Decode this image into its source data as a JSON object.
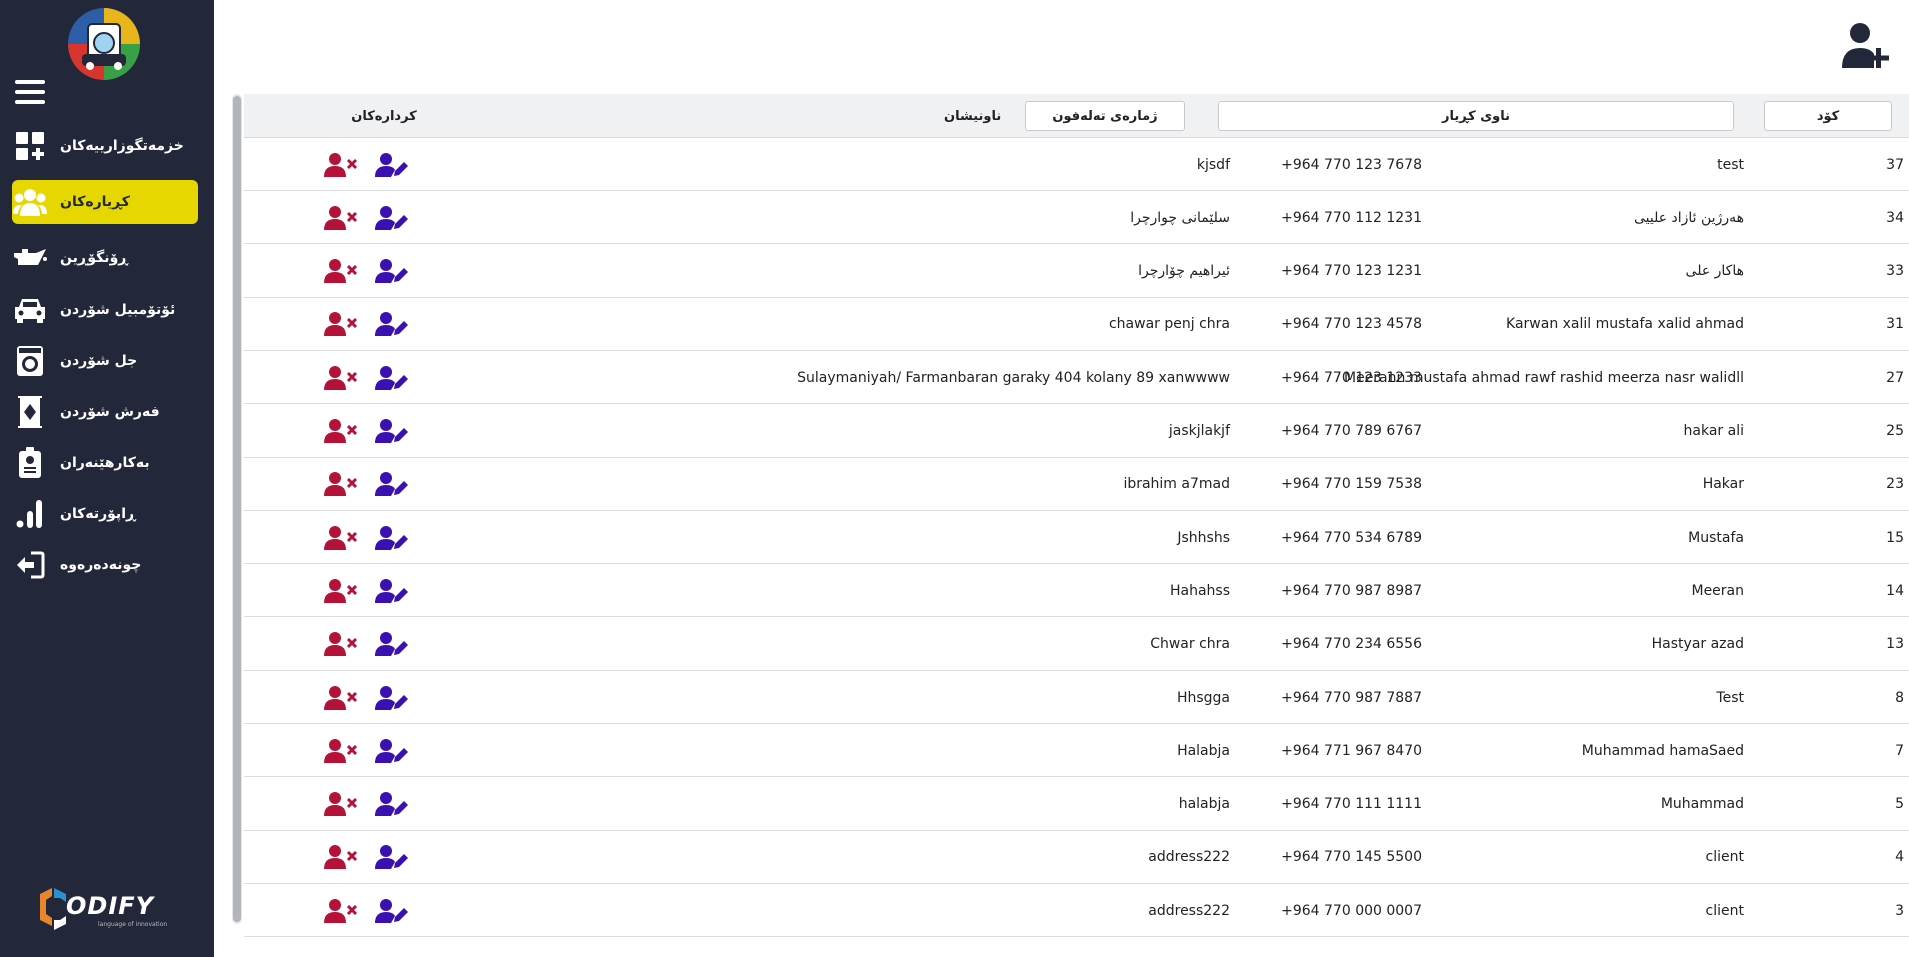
{
  "sidebar": {
    "items": [
      {
        "label": "خزمەتگوزارییەکان",
        "icon": "services-grid-icon",
        "active": false
      },
      {
        "label": "کڕیارەکان",
        "icon": "customers-group-icon",
        "active": true
      },
      {
        "label": "ڕۆنگۆڕین",
        "icon": "oil-can-icon",
        "active": false
      },
      {
        "label": "ئۆتۆمبیل شۆردن",
        "icon": "car-icon",
        "active": false
      },
      {
        "label": "جل شۆردن",
        "icon": "washing-machine-icon",
        "active": false
      },
      {
        "label": "فەرش شۆردن",
        "icon": "carpet-icon",
        "active": false
      },
      {
        "label": "بەکارهێنەران",
        "icon": "id-badge-icon",
        "active": false
      },
      {
        "label": "ڕاپۆرتەکان",
        "icon": "bar-chart-icon",
        "active": false
      },
      {
        "label": "چونەدەرەوە",
        "icon": "logout-icon",
        "active": false
      }
    ]
  },
  "brand": {
    "name": "ODIFY",
    "tagline": "language of innovation"
  },
  "table": {
    "headers": {
      "code": "کۆد",
      "name": "ناوی کڕیار",
      "phone": "ژمارەی تەلەفون",
      "address": "ناونیشان",
      "actions": "کردارەکان"
    },
    "rows": [
      {
        "code": "37",
        "name": "test",
        "phone": "+964 770 123 7678",
        "address": "kjsdf"
      },
      {
        "code": "34",
        "name": "هەرژین ئازاد علییی",
        "phone": "+964 770 112 1231",
        "address": "سلێمانی چوارچرا"
      },
      {
        "code": "33",
        "name": "هاکار علی",
        "phone": "+964 770 123 1231",
        "address": "ئیراهیم چۆارچرا"
      },
      {
        "code": "31",
        "name": "Karwan xalil mustafa xalid ahmad",
        "phone": "+964 770 123 4578",
        "address": "chawar penj chra"
      },
      {
        "code": "27",
        "name": "Meerann mustafa ahmad rawf rashid meerza nasr walidll",
        "phone": "+964 770 123 1233",
        "address": "Sulaymaniyah/ Farmanbaran garaky 404 kolany 89 xanwwww"
      },
      {
        "code": "25",
        "name": "hakar ali",
        "phone": "+964 770 789 6767",
        "address": "jaskjlakjf"
      },
      {
        "code": "23",
        "name": "Hakar",
        "phone": "+964 770 159 7538",
        "address": "ibrahim a7mad"
      },
      {
        "code": "15",
        "name": "Mustafa",
        "phone": "+964 770 534 6789",
        "address": "Jshhshs"
      },
      {
        "code": "14",
        "name": "Meeran",
        "phone": "+964 770 987 8987",
        "address": "Hahahss"
      },
      {
        "code": "13",
        "name": "Hastyar azad",
        "phone": "+964 770 234 6556",
        "address": "Chwar chra"
      },
      {
        "code": "8",
        "name": "Test",
        "phone": "+964 770 987 7887",
        "address": "Hhsgga"
      },
      {
        "code": "7",
        "name": "Muhammad hamaSaed",
        "phone": "+964 771 967 8470",
        "address": "Halabja"
      },
      {
        "code": "5",
        "name": "Muhammad",
        "phone": "+964 770 111 1111",
        "address": "halabja"
      },
      {
        "code": "4",
        "name": "client",
        "phone": "+964 770 145 5500",
        "address": "address222"
      },
      {
        "code": "3",
        "name": "client",
        "phone": "+964 770 000 0007",
        "address": "address222"
      }
    ]
  },
  "colors": {
    "sidebar_bg": "#23273a",
    "active_item": "#e6d700",
    "delete_icon": "#b5123a",
    "edit_icon": "#3a10b0"
  }
}
